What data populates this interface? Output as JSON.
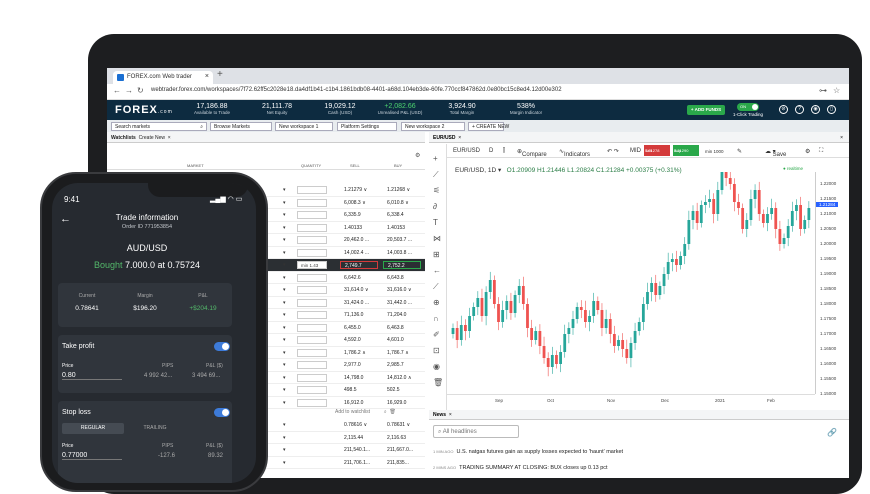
{
  "browser": {
    "tab_title": "FOREX.com Web trader",
    "url": "webtrader.forex.com/workspaces/7f72.62ff5c2028e18.da4df1b41-c1b4.1861bdb08-4401-a68d.104eb3de-60fe.770ccf847862d.0e80bc15c8ed4.12d00e302"
  },
  "header": {
    "logo": "FOREX",
    "logo_suffix": ".com",
    "stats": [
      {
        "value": "17,186.88",
        "label": "Available to Trade"
      },
      {
        "value": "21,111.78",
        "label": "Net Equity"
      },
      {
        "value": "19,029.12",
        "label": "Cash (USD)"
      },
      {
        "value": "+2,082.66",
        "label": "Unrealised P&L (USD)"
      },
      {
        "value": "3,924.90",
        "label": "Total Margin"
      },
      {
        "value": "538%",
        "label": "Margin Indicator"
      }
    ],
    "add_funds": "+ ADD FUNDS",
    "toggle": "ON",
    "one_click": "1-Click Trading"
  },
  "workspace": {
    "search": "Search markets",
    "browse": "Browse Markets",
    "ws1": "New workspace 1",
    "platform": "Platform Settings",
    "ws2": "New workspace 2",
    "create": "+ CREATE NEW"
  },
  "watchlist": {
    "tab": "Watchlists",
    "create": "Create New",
    "cols": {
      "market": "MARKET",
      "quantity": "QUANTITY",
      "sell": "SELL",
      "buy": "BUY"
    },
    "rows": [
      {
        "qty": "",
        "sell": "1.21279 ∨",
        "buy": "1.21268 ∨"
      },
      {
        "qty": "",
        "sell": "6,008.3 ∨",
        "buy": "6,010.8 ∨"
      },
      {
        "qty": "",
        "sell": "6,335.9",
        "buy": "6,338.4"
      },
      {
        "qty": "",
        "sell": "1.40133",
        "buy": "1.40153"
      },
      {
        "qty": "",
        "sell": "20,462.0 ...",
        "buy": "20,503.7 ..."
      },
      {
        "qty": "",
        "sell": "14,002.4 ...",
        "buy": "14,003.8 ..."
      },
      {
        "qty": "min 1.43",
        "sell": "2,749.7",
        "buy": "2,752.2"
      },
      {
        "qty": "",
        "sell": "6,642.6",
        "buy": "6,643.8"
      },
      {
        "qty": "",
        "sell": "31,614.0 ∨",
        "buy": "31,616.0 ∨"
      },
      {
        "qty": "",
        "sell": "31,424.0 ...",
        "buy": "31,442.0 ..."
      },
      {
        "qty": "",
        "sell": "71,136.0",
        "buy": "71,204.0"
      },
      {
        "qty": "",
        "sell": "6,455.0",
        "buy": "6,463.8"
      },
      {
        "qty": "",
        "sell": "4,592.0",
        "buy": "4,601.0"
      },
      {
        "qty": "",
        "sell": "1,786.2 ∧",
        "buy": "1,786.7 ∧"
      },
      {
        "qty": "",
        "sell": "2,977.0",
        "buy": "2,985.7"
      },
      {
        "qty": "",
        "sell": "14,798.0",
        "buy": "14,812.0 ∧"
      },
      {
        "qty": "",
        "sell": "498.5",
        "buy": "502.5"
      },
      {
        "qty": "",
        "sell": "16,912.0",
        "buy": "16,929.0"
      }
    ],
    "add_to_watchlist": "Add to watchlist",
    "rows2": [
      {
        "sell": "0.78616 ∨",
        "buy": "0.78631 ∨"
      },
      {
        "sell": "2,115.44",
        "buy": "2,116.63"
      },
      {
        "sell": "211,540.1...",
        "buy": "211,667.0..."
      },
      {
        "sell": "211,706.1...",
        "buy": "211,835..."
      }
    ]
  },
  "chart": {
    "tab": "EUR/USD",
    "symbol": "EUR/USD",
    "interval": "D",
    "compare": "Compare",
    "indicators": "Indicators",
    "mid": "MID",
    "sell_label": "Sell",
    "sell_price": "1.21278",
    "buy_label": "Buy",
    "buy_price": "1.21290",
    "min": "min 1000",
    "save": "Save",
    "realtime": "● realtime",
    "ohlc_name": "EUR/USD, 1D ▾",
    "o": "O1.20909",
    "h": "H1.21446",
    "l": "L1.20824",
    "c": "C1.21284",
    "chg": "+0.00375 (+0.31%)"
  },
  "chart_data": {
    "type": "candlestick",
    "x_ticks": [
      "Sep",
      "Oct",
      "Nov",
      "Dec",
      "2021",
      "Feb"
    ],
    "y_ticks": [
      "1.22000",
      "1.21500",
      "1.21000",
      "1.20500",
      "1.20000",
      "1.19500",
      "1.19000",
      "1.18500",
      "1.18000",
      "1.17500",
      "1.17000",
      "1.16500",
      "1.16000",
      "1.15500",
      "1.15000"
    ],
    "ylim": [
      1.15,
      1.224
    ],
    "last_price": "1.21284",
    "closes": [
      1.172,
      1.168,
      1.173,
      1.171,
      1.176,
      1.179,
      1.182,
      1.176,
      1.184,
      1.188,
      1.18,
      1.174,
      1.178,
      1.181,
      1.177,
      1.183,
      1.186,
      1.18,
      1.172,
      1.168,
      1.171,
      1.166,
      1.162,
      1.159,
      1.163,
      1.16,
      1.164,
      1.17,
      1.172,
      1.175,
      1.179,
      1.178,
      1.174,
      1.176,
      1.181,
      1.178,
      1.172,
      1.175,
      1.17,
      1.166,
      1.168,
      1.165,
      1.162,
      1.167,
      1.171,
      1.174,
      1.18,
      1.184,
      1.187,
      1.183,
      1.186,
      1.19,
      1.194,
      1.195,
      1.193,
      1.196,
      1.2,
      1.208,
      1.211,
      1.207,
      1.213,
      1.214,
      1.215,
      1.21,
      1.218,
      1.224,
      1.222,
      1.22,
      1.214,
      1.212,
      1.205,
      1.208,
      1.215,
      1.218,
      1.21,
      1.207,
      1.21,
      1.212,
      1.205,
      1.2,
      1.202,
      1.206,
      1.211,
      1.213,
      1.205,
      1.208,
      1.212
    ]
  },
  "news": {
    "tab": "News",
    "search": "All headlines",
    "items": [
      {
        "time": "1 MIN AGO",
        "text": "U.S. natgas futures gain as supply losses expected to 'haunt' market"
      },
      {
        "time": "2 MINS AGO",
        "text": "TRADING SUMMARY AT CLOSING: BUX closes up 0.13 pct"
      }
    ]
  },
  "phone": {
    "time": "9:41",
    "title": "Trade information",
    "order": "Order ID 771953854",
    "pair": "AUD/USD",
    "bought": "Bought",
    "bought_detail": "7.000.0 at 0.75724",
    "current_label": "Current",
    "current": "0.78641",
    "margin_label": "Margin",
    "margin": "$196.20",
    "pl_label": "P&L",
    "pl": "+$204.19",
    "tp_label": "Take profit",
    "price_label": "Price",
    "pips_label": "PIPS",
    "plusd_label": "P&L ($)",
    "tp_price": "0.80",
    "tp_pips": "4 992 42...",
    "tp_pl": "3 494 69...",
    "sl_label": "Stop loss",
    "regular": "REGULAR",
    "trailing": "TRAILING",
    "sl_price": "0.77000",
    "sl_pips": "-127.6",
    "sl_pl": "89.32"
  },
  "colors": {
    "header": "#0d2b40",
    "green": "#2aa84a",
    "red": "#d43b3b",
    "phone_bg": "#262a30"
  }
}
